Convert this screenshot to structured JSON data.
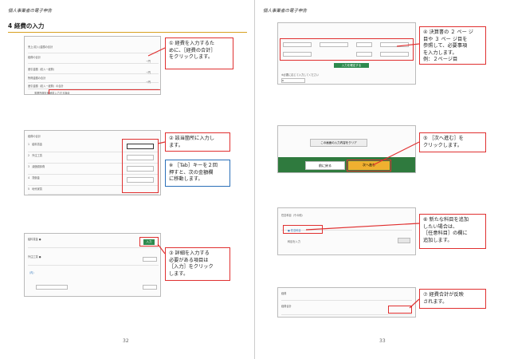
{
  "header": {
    "left": "個人事業者の電子申告",
    "right": "個人事業者の電子申告"
  },
  "section_title": "4  経費の入力",
  "page_numbers": {
    "left": "32",
    "right": "33"
  },
  "shot1": {
    "rows": [
      "売上(収入)金額の合計",
      "経費の合計",
      "差引金額（収入－経費）",
      "所得金額の合計",
      "差引金額（収入－経費）の合計",
      "事業所得を明細書入力する場合"
    ],
    "values": [
      "−円",
      "−円",
      "−円"
    ]
  },
  "shot2": {
    "header": "経費の合計",
    "rows": [
      "1",
      "2",
      "3",
      "4",
      "5"
    ],
    "labels": [
      "給料賃金",
      "外注工賃",
      "減価償却費",
      "貸倒金",
      "地代家賃"
    ]
  },
  "shot3": {
    "row1": "給料賃金",
    "button": "入力",
    "row2": "外注工賃",
    "row3": "（内）"
  },
  "shot4": {
    "button": "入力を確定する",
    "note": "※必要に応じて入力してください",
    "small_input": "0"
  },
  "shot5": {
    "clear": "この画面の入力内容をクリア",
    "back": "前に戻る",
    "next": "次へ進む"
  },
  "shot6": {
    "title": "任意科目（その他）",
    "item": "任意科目",
    "option": "科目を入力"
  },
  "shot7": {
    "row1": "経費",
    "row2": "経費合計"
  },
  "callouts": {
    "c1": [
      "①  経費を入力するた",
      "めに、［経費の合計］",
      "をクリックします。"
    ],
    "c2": [
      "②  該当箇所に入力し",
      "ます。"
    ],
    "note": [
      "※  ［Tab］キーを２回",
      "押すと、次の金額欄",
      "に移動します。"
    ],
    "c3": [
      "③  詳細を入力する",
      "必要がある項目は",
      "［入力］をクリック",
      "します。"
    ],
    "c4": [
      "④  決算書の ２ ペー ジ",
      "目や ３ ペー ジ目を",
      "参照して、必要事項",
      "を入力します。",
      "例：２ページ目"
    ],
    "c5": [
      "⑤  ［次へ進む］を",
      "クリックします。"
    ],
    "c6": [
      "⑥  新たな科目を追加",
      "したい場合は、",
      "［任意科目］の欄に",
      "追加します。"
    ],
    "c7": [
      "⑦  経費合計が反映",
      "されます。"
    ]
  }
}
